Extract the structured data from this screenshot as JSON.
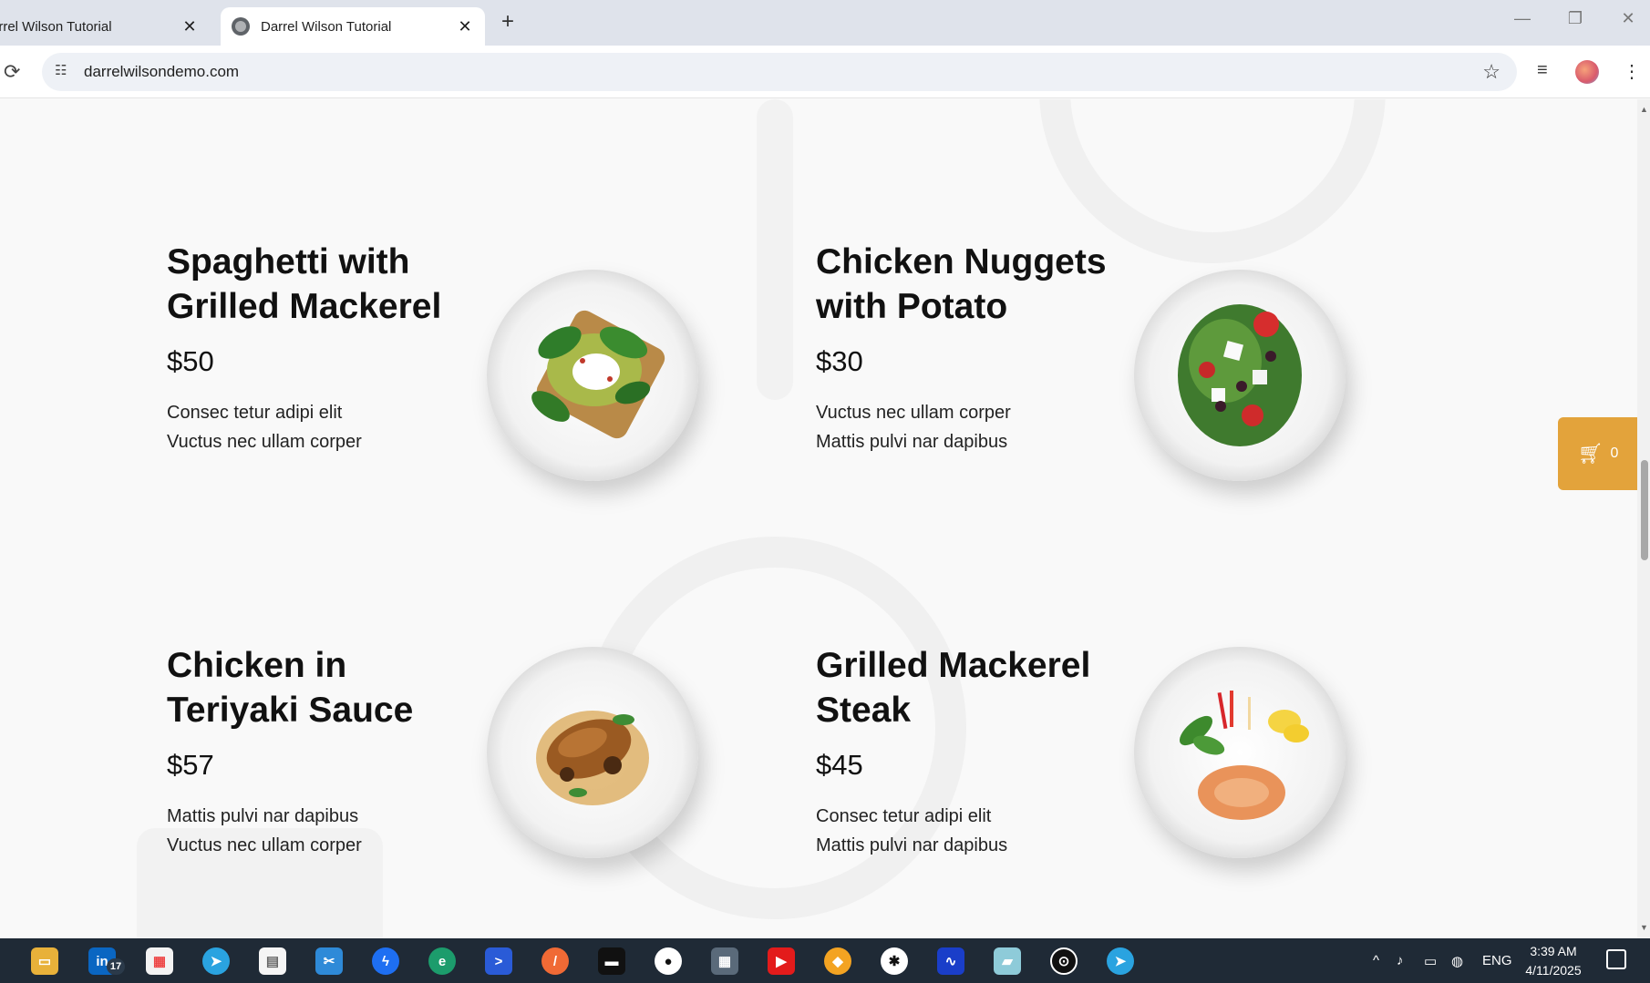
{
  "browser": {
    "tabs": [
      {
        "title": "arrel Wilson Tutorial",
        "close": "✕"
      },
      {
        "title": "Darrel Wilson Tutorial",
        "close": "✕"
      }
    ],
    "new_tab": "+",
    "url": "darrelwilsondemo.com",
    "window_controls": {
      "minimize": "—",
      "restore": "❐",
      "close": "✕"
    }
  },
  "menu": [
    {
      "name": "Spaghetti with Grilled Mackerel",
      "price": "$50",
      "desc_line1": "Consec tetur adipi elit",
      "desc_line2": "Vuctus nec ullam corper",
      "image": "avocado-toast-plate"
    },
    {
      "name": "Chicken Nuggets with Potato",
      "price": "$30",
      "desc_line1": "Vuctus nec ullam corper",
      "desc_line2": "Mattis pulvi nar dapibus",
      "image": "greek-salad-plate"
    },
    {
      "name": "Chicken in Teriyaki Sauce",
      "price": "$57",
      "desc_line1": "Mattis pulvi nar dapibus",
      "desc_line2": "Vuctus nec ullam corper",
      "image": "teriyaki-chicken-plate"
    },
    {
      "name": "Grilled Mackerel Steak",
      "price": "$45",
      "desc_line1": "Consec tetur adipi elit",
      "desc_line2": "Mattis pulvi nar dapibus",
      "image": "mackerel-steak-plate"
    }
  ],
  "cart": {
    "count": "0",
    "icon": "cart-icon"
  },
  "taskbar": {
    "linkedin_badge": "17",
    "lang": "ENG",
    "time": "3:39 AM",
    "date": "4/11/2025"
  },
  "colors": {
    "accent": "#e3a33b",
    "taskbar": "#1f2a36"
  }
}
